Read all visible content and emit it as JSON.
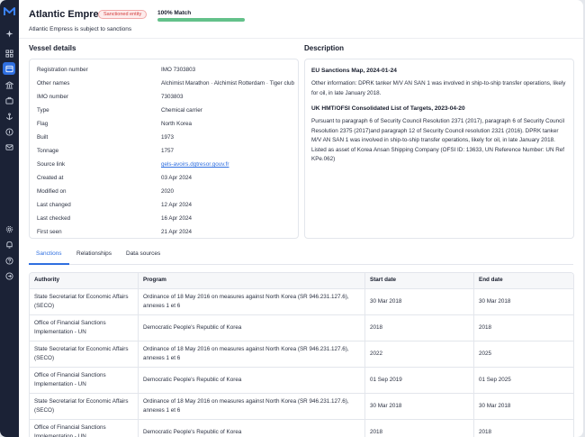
{
  "header": {
    "title": "Atlantic Empress",
    "badge": "Sanctioned entity",
    "subtitle": "Atlantic Empress is subject to sanctions",
    "match_label": "100% Match",
    "match_percent": 100
  },
  "vessel": {
    "section_title": "Vessel details",
    "rows": [
      {
        "key": "Registration number",
        "value": "IMO 7303803"
      },
      {
        "key": "Other names",
        "value": "Alchimist Marathon · Alchimist Rotterdam · Tiger club"
      },
      {
        "key": "IMO number",
        "value": "7303803"
      },
      {
        "key": "Type",
        "value": "Chemical carrier"
      },
      {
        "key": "Flag",
        "value": "North Korea"
      },
      {
        "key": "Built",
        "value": "1973"
      },
      {
        "key": "Tonnage",
        "value": "1757"
      },
      {
        "key": "Source link",
        "value": "gels-avoirs.dgtresor.gouv.fr",
        "link": true
      },
      {
        "key": "Created at",
        "value": "03 Apr 2024"
      },
      {
        "key": "Modified on",
        "value": "2020"
      },
      {
        "key": "Last changed",
        "value": "12 Apr 2024"
      },
      {
        "key": "Last checked",
        "value": "16 Apr 2024"
      },
      {
        "key": "First seen",
        "value": "21 Apr 2024"
      }
    ]
  },
  "description": {
    "section_title": "Description",
    "entries": [
      {
        "title": "EU Sanctions Map, 2024-01-24",
        "text": "Other information: DPRK tanker M/V AN SAN 1 was involved in ship-to-ship transfer operations, likely for oil, in late January 2018."
      },
      {
        "title": "UK HMT/OFSI Consolidated List of Targets, 2023-04-20",
        "text": "Pursuant to paragraph 6 of Security Council Resolution 2371 (2017), paragraph 6 of Security Council Resolution 2375 (2017)and paragraph 12 of Security Council resolution 2321 (2016). DPRK tanker M/V AN SAN 1 was involved in ship-to-ship transfer operations, likely for oil, in late January 2018. Listed as asset of Korea Ansan Shipping Company (OFSI ID: 13633, UN Reference Number: UN Ref KPe.062)"
      }
    ]
  },
  "tabs": [
    {
      "label": "Sanctions",
      "active": true
    },
    {
      "label": "Relationships",
      "active": false
    },
    {
      "label": "Data sources",
      "active": false
    }
  ],
  "table": {
    "columns": [
      "Authority",
      "Program",
      "Start date",
      "End date"
    ],
    "rows": [
      [
        "State Secretariat for Economic Affairs (SECO)",
        "Ordinance of 18 May 2016 on measures against North Korea (SR 946.231.127.6), annexes 1 et 6",
        "30 Mar 2018",
        "30 Mar 2018"
      ],
      [
        "Office of Financial Sanctions Implementation - UN",
        "Democratic People's Republic of Korea",
        "2018",
        "2018"
      ],
      [
        "State Secretariat for Economic Affairs (SECO)",
        "Ordinance of 18 May 2016 on measures against North Korea (SR 946.231.127.6), annexes 1 et 6",
        "2022",
        "2025"
      ],
      [
        "Office of Financial Sanctions Implementation - UN",
        "Democratic People's Republic of Korea",
        "01 Sep 2019",
        "01 Sep 2025"
      ],
      [
        "State Secretariat for Economic Affairs (SECO)",
        "Ordinance of 18 May 2016 on measures against North Korea (SR 946.231.127.6), annexes 1 et 6",
        "30 Mar 2018",
        "30 Mar 2018"
      ],
      [
        "Office of Financial Sanctions Implementation - UN",
        "Democratic People's Republic of Korea",
        "2018",
        "2018"
      ]
    ]
  },
  "colors": {
    "accent": "#2f6fe0",
    "sanction_red": "#d23b3b",
    "match_green": "#63c18a",
    "sidebar": "#1b2236"
  },
  "rail_icons": [
    "logo-icon",
    "sparkle-icon",
    "grid-icon",
    "dashboard-icon",
    "bank-icon",
    "briefcase-icon",
    "anchor-icon",
    "coin-icon",
    "mail-icon",
    "settings-icon",
    "bell-icon",
    "help-icon",
    "logout-icon"
  ]
}
